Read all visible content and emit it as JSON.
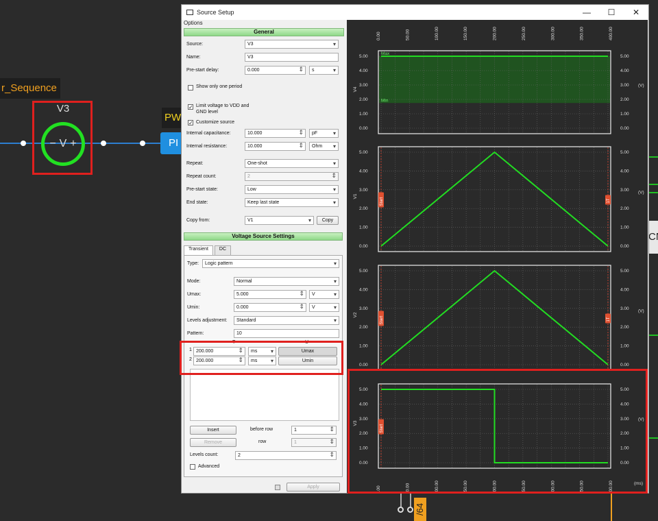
{
  "schematic": {
    "sequence_label": "r_Sequence",
    "component_name": "V3",
    "symbol_minus": "−",
    "symbol_v": "V",
    "symbol_plus": "+",
    "pw_tab": "PW",
    "pi_block": "PI",
    "cn_block": "CN",
    "bottom_tag": "/64"
  },
  "dialog": {
    "title": "Source Setup",
    "menu": "Options",
    "window_buttons": [
      "—",
      "☐",
      "✕"
    ],
    "general": {
      "header": "General",
      "source_label": "Source:",
      "source_value": "V3",
      "name_label": "Name:",
      "name_value": "V3",
      "prestart_delay_label": "Pre-start delay:",
      "prestart_delay_value": "0.000",
      "prestart_delay_unit": "s",
      "show_one_period": "Show only one period",
      "limit_voltage": "Limit voltage to VDD and GND level",
      "customize_source": "Customize source",
      "int_cap_label": "Internal capacitance:",
      "int_cap_value": "10.000",
      "int_cap_unit": "pF",
      "int_res_label": "Internal resistance:",
      "int_res_value": "10.000",
      "int_res_unit": "Ohm",
      "repeat_label": "Repeat:",
      "repeat_value": "One-shot",
      "repeat_count_label": "Repeat count:",
      "repeat_count_value": "2",
      "prestart_state_label": "Pre-start state:",
      "prestart_state_value": "Low",
      "end_state_label": "End state:",
      "end_state_value": "Keep last state",
      "copy_from_label": "Copy from:",
      "copy_from_value": "V1",
      "copy_button": "Copy"
    },
    "vss": {
      "header": "Voltage Source Settings",
      "tab_transient": "Transient",
      "tab_dc": "DC",
      "type_label": "Type:",
      "type_value": "Logic pattern",
      "mode_label": "Mode:",
      "mode_value": "Normal",
      "umax_label": "Umax:",
      "umax_value": "5.000",
      "umax_unit": "V",
      "umin_label": "Umin:",
      "umin_value": "0.000",
      "umin_unit": "V",
      "levels_adj_label": "Levels adjustment:",
      "levels_adj_value": "Standard",
      "pattern_label": "Pattern:",
      "pattern_value": "10",
      "col_t": "T",
      "col_u": "U",
      "rows": [
        {
          "idx": "1",
          "time": "200.000",
          "unit": "ms",
          "level": "Umax"
        },
        {
          "idx": "2",
          "time": "200.000",
          "unit": "ms",
          "level": "Umin"
        }
      ],
      "insert_button": "Insert",
      "before_row_label": "before row",
      "before_row_value": "1",
      "remove_button": "Remove",
      "row_label": "row",
      "row_value": "1",
      "levels_count_label": "Levels count:",
      "levels_count_value": "2",
      "advanced_label": "Advanced",
      "apply_button": "Apply"
    }
  },
  "chart_data": [
    {
      "type": "line",
      "ylabel": "V4",
      "right_label": "(V)",
      "x": [
        0,
        400
      ],
      "y": [
        5,
        5
      ],
      "ylim": [
        0,
        5
      ],
      "xlim": [
        0,
        400
      ],
      "annotations": [
        "Max",
        "Min"
      ],
      "band": [
        1.75,
        5
      ]
    },
    {
      "type": "line",
      "ylabel": "V1",
      "right_label": "(V)",
      "x": [
        0,
        200,
        400
      ],
      "y": [
        0,
        5,
        0
      ],
      "ylim": [
        0,
        5
      ],
      "xlim": [
        0,
        400
      ],
      "markers": [
        "Start",
        "1T"
      ]
    },
    {
      "type": "line",
      "ylabel": "V2",
      "right_label": "(V)",
      "x": [
        0,
        200,
        400
      ],
      "y": [
        0,
        5,
        0
      ],
      "ylim": [
        0,
        5
      ],
      "xlim": [
        0,
        400
      ],
      "markers": [
        "Start",
        "1T"
      ]
    },
    {
      "type": "line",
      "ylabel": "V3",
      "right_label": "(V)",
      "xlabel_unit": "(ms)",
      "x": [
        0,
        200,
        200,
        400
      ],
      "y": [
        5,
        5,
        0,
        0
      ],
      "ylim": [
        0,
        5
      ],
      "xlim": [
        0,
        400
      ],
      "markers": [
        "Start"
      ]
    }
  ],
  "axis": {
    "x_ticks": [
      "0.00",
      "50.00",
      "100.00",
      "150.00",
      "200.00",
      "250.00",
      "300.00",
      "350.00",
      "400.00"
    ],
    "y_ticks": [
      "0.00",
      "1.00",
      "2.00",
      "3.00",
      "4.00",
      "5.00"
    ]
  },
  "colors": {
    "trace": "#22dd22",
    "highlight": "#e0201e",
    "marker": "#e05030"
  }
}
